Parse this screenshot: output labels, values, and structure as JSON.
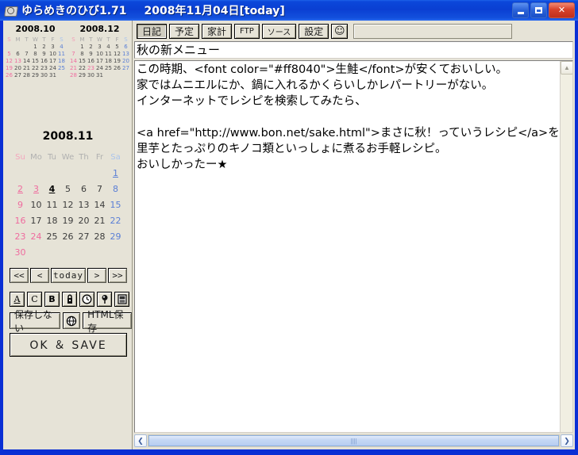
{
  "window": {
    "app_title": "ゆらめきのひび1.71",
    "date_title": "2008年11月04日[today]",
    "icon": "app-disc-icon",
    "controls": {
      "minimize": "minimize-button",
      "maximize": "maximize-button",
      "close_glyph": "✕"
    }
  },
  "sidebar": {
    "mini_calendars": [
      {
        "title": "2008.10",
        "weekday_headers": [
          "S",
          "M",
          "T",
          "W",
          "T",
          "F",
          "S"
        ],
        "leading_blanks": 3,
        "days": [
          1,
          2,
          3,
          4,
          5,
          6,
          7,
          8,
          9,
          10,
          11,
          12,
          13,
          14,
          15,
          16,
          17,
          18,
          19,
          20,
          21,
          22,
          23,
          24,
          25,
          26,
          27,
          28,
          29,
          30,
          31
        ],
        "holidays": [
          13
        ]
      },
      {
        "title": "2008.12",
        "weekday_headers": [
          "S",
          "M",
          "T",
          "W",
          "T",
          "F",
          "S"
        ],
        "leading_blanks": 1,
        "days": [
          1,
          2,
          3,
          4,
          5,
          6,
          7,
          8,
          9,
          10,
          11,
          12,
          13,
          14,
          15,
          16,
          17,
          18,
          19,
          20,
          21,
          22,
          23,
          24,
          25,
          26,
          27,
          28,
          29,
          30,
          31
        ],
        "holidays": [
          23
        ]
      }
    ],
    "main_calendar": {
      "title": "2008.11",
      "weekday_headers": [
        "Su",
        "Mo",
        "Tu",
        "We",
        "Th",
        "Fr",
        "Sa"
      ],
      "leading_blanks": 6,
      "days": [
        1,
        2,
        3,
        4,
        5,
        6,
        7,
        8,
        9,
        10,
        11,
        12,
        13,
        14,
        15,
        16,
        17,
        18,
        19,
        20,
        21,
        22,
        23,
        24,
        25,
        26,
        27,
        28,
        29,
        30
      ],
      "linked_days": [
        1,
        2,
        3,
        4
      ],
      "today": 4,
      "holidays": [
        3,
        24
      ]
    },
    "nav_buttons": [
      {
        "label": "<<",
        "name": "nav-prev-year-button"
      },
      {
        "label": "<",
        "name": "nav-prev-month-button"
      },
      {
        "label": "today",
        "name": "nav-today-button"
      },
      {
        "label": ">",
        "name": "nav-next-month-button"
      },
      {
        "label": ">>",
        "name": "nav-next-year-button"
      }
    ],
    "format_buttons": [
      {
        "label": "A",
        "name": "underline-format-button"
      },
      {
        "label": "C",
        "name": "color-format-button"
      },
      {
        "label": "B",
        "name": "bold-format-button"
      },
      {
        "label": "",
        "name": "lock-icon-button"
      },
      {
        "label": "",
        "name": "clock-icon-button"
      },
      {
        "label": "",
        "name": "balloon-icon-button"
      },
      {
        "label": "",
        "name": "image-icon-button"
      }
    ],
    "save_row": {
      "no_save_label": "保存しない",
      "globe_label": "",
      "html_save_label": "HTML保存"
    },
    "ok_save_label": "OK ＆ SAVE"
  },
  "main": {
    "tabs": [
      {
        "label": "日記",
        "name": "tab-diary",
        "active": true
      },
      {
        "label": "予定",
        "name": "tab-schedule",
        "active": false
      },
      {
        "label": "家計",
        "name": "tab-household",
        "active": false
      },
      {
        "label": "FTP",
        "name": "tab-ftp",
        "active": false
      },
      {
        "label": "ソース",
        "name": "tab-source",
        "active": false
      },
      {
        "label": "設定",
        "name": "tab-settings",
        "active": false
      }
    ],
    "smiley_label": "☺",
    "entry_title": "秋の新メニュー",
    "entry_title_placeholder": "",
    "entry_body": "この時期、<font color=\"#ff8040\">生鮭</font>が安くておいしい。\n家ではムニエルにか、鍋に入れるかくらいしかレパートリーがない。\nインターネットでレシピを検索してみたら、\n\n<a href=\"http://www.bon.net/sake.html\">まさに秋！っていうレシピ</a>を発見。\n里芋とたっぷりのキノコ類といっしょに煮るお手軽レシピ。\nおいしかったー★",
    "scroll": {
      "v_up_glyph": "▲",
      "h_left_glyph": "❮",
      "h_right_glyph": "❯",
      "h_grip": "||||"
    }
  },
  "colors": {
    "titlebar_blue": "#0a3fd2",
    "panel_beige": "#e6e3d7",
    "sunday_pink": "#ef6b9e",
    "saturday_blue": "#5a7fd6",
    "close_red": "#d8422a"
  }
}
